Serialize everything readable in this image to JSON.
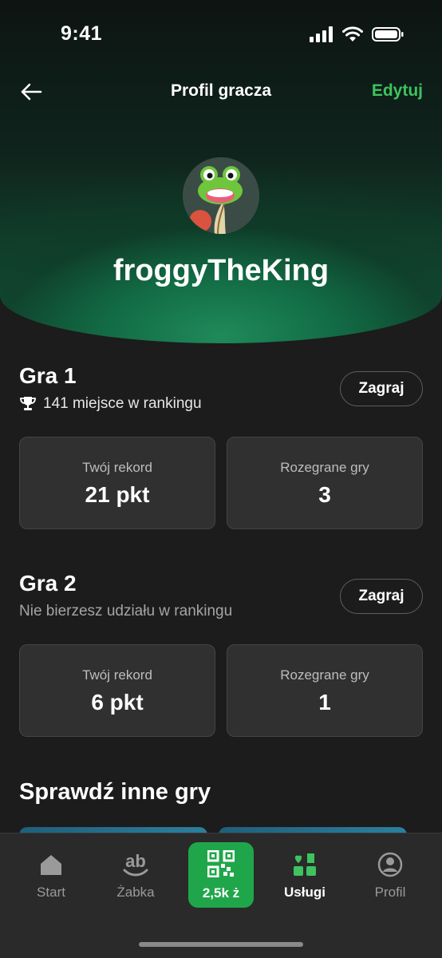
{
  "status": {
    "time": "9:41"
  },
  "nav": {
    "title": "Profil gracza",
    "edit_label": "Edytuj"
  },
  "profile": {
    "username": "froggyTheKing"
  },
  "games": [
    {
      "title": "Gra 1",
      "subtitle": "141 miejsce w rankingu",
      "play_label": "Zagraj",
      "stats": [
        {
          "label": "Twój rekord",
          "value": "21 pkt"
        },
        {
          "label": "Rozegrane gry",
          "value": "3"
        }
      ]
    },
    {
      "title": "Gra 2",
      "subtitle": "Nie bierzesz udziału w rankingu",
      "play_label": "Zagraj",
      "stats": [
        {
          "label": "Twój rekord",
          "value": "6 pkt"
        },
        {
          "label": "Rozegrane gry",
          "value": "1"
        }
      ]
    }
  ],
  "other_games": {
    "title": "Sprawdź inne gry"
  },
  "tabbar": {
    "items": [
      {
        "label": "Start",
        "icon": "home-icon"
      },
      {
        "label": "Żabka",
        "icon": "zabka-logo-icon"
      },
      {
        "label": "2,5k ż",
        "icon": "qr-code-icon"
      },
      {
        "label": "Usługi",
        "icon": "services-icon",
        "active": true
      },
      {
        "label": "Profil",
        "icon": "profile-icon"
      }
    ]
  },
  "colors": {
    "accent": "#3ec35f",
    "qr_button": "#20a64a",
    "background": "#1c1c1c",
    "card": "#303030"
  }
}
